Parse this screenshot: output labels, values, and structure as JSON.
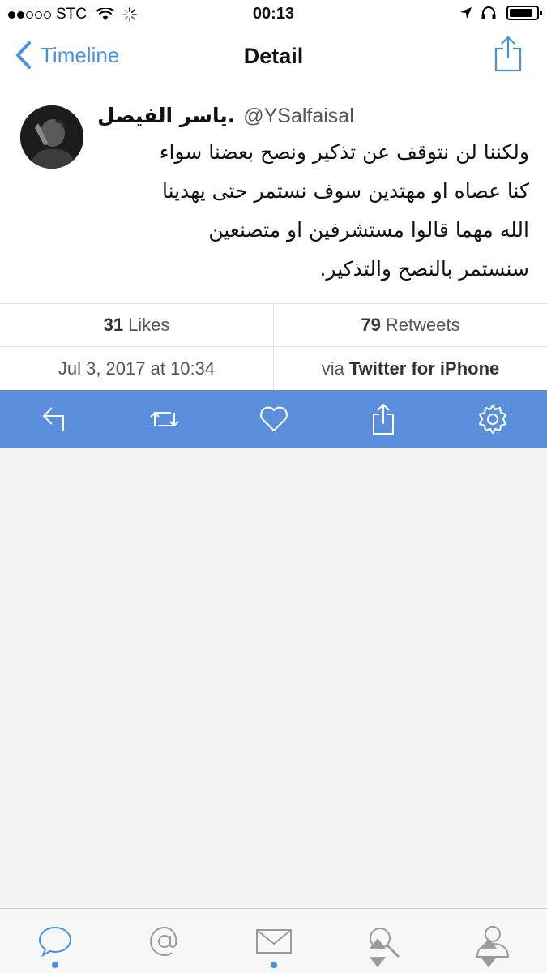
{
  "status_bar": {
    "carrier": "STC",
    "time": "00:13",
    "signal_bars": 2,
    "battery_level": 0.85
  },
  "nav": {
    "back_label": "Timeline",
    "title": "Detail"
  },
  "tweet": {
    "display_name": "ياسر الفيصل.",
    "username": "@YSalfaisal",
    "lines": [
      "ولكننا لن نتوقف عن تذكير ونصح بعضنا سواء",
      "كنا عصاه او مهتدين سوف نستمر حتى يهدينا",
      "الله مهما قالوا مستشرفين او متصنعين",
      "سنستمر بالنصح والتذكير."
    ]
  },
  "stats": {
    "likes_count": "31",
    "likes_label": "Likes",
    "retweets_count": "79",
    "retweets_label": "Retweets"
  },
  "meta": {
    "date": "Jul 3, 2017 at 10:34",
    "via_label": "via",
    "client": "Twitter for iPhone"
  },
  "actions": [
    "reply-icon",
    "retweet-icon",
    "heart-icon",
    "share-icon",
    "gear-icon"
  ],
  "tabs": [
    {
      "icon": "chat-bubble-icon",
      "active": true
    },
    {
      "icon": "at-sign-icon",
      "active": false
    },
    {
      "icon": "envelope-icon",
      "active": true
    },
    {
      "icon": "search-icon",
      "active": false
    },
    {
      "icon": "person-icon",
      "active": false
    }
  ],
  "colors": {
    "accent": "#4a90e2",
    "action_bar": "#5b8fdc",
    "icon_gray": "#9b9b9b"
  }
}
